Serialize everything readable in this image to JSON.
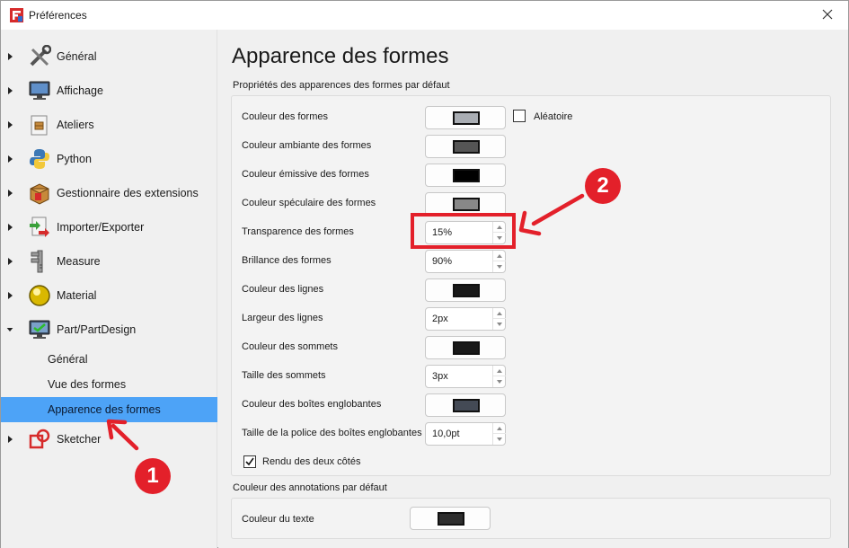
{
  "window": {
    "title": "Préférences"
  },
  "sidebar": {
    "items": [
      {
        "label": "Général",
        "icon": "tools-icon"
      },
      {
        "label": "Affichage",
        "icon": "monitor-icon"
      },
      {
        "label": "Ateliers",
        "icon": "workbench-icon"
      },
      {
        "label": "Python",
        "icon": "python-icon"
      },
      {
        "label": "Gestionnaire des extensions",
        "icon": "addon-manager-icon"
      },
      {
        "label": "Importer/Exporter",
        "icon": "import-export-icon"
      },
      {
        "label": "Measure",
        "icon": "caliper-icon"
      },
      {
        "label": "Material",
        "icon": "material-sphere-icon"
      },
      {
        "label": "Part/PartDesign",
        "icon": "part-design-icon",
        "expanded": true
      }
    ],
    "subitems": [
      {
        "label": "Général"
      },
      {
        "label": "Vue des formes"
      },
      {
        "label": "Apparence des formes",
        "selected": true
      }
    ],
    "last_item": {
      "label": "Sketcher",
      "icon": "sketcher-icon"
    }
  },
  "main": {
    "title": "Apparence des formes",
    "group1": {
      "title": "Propriétés des apparences des formes par défaut",
      "rows": [
        {
          "label": "Couleur des formes",
          "type": "color",
          "color": "#a9adb3"
        },
        {
          "label": "Couleur ambiante des formes",
          "type": "color",
          "color": "#555555"
        },
        {
          "label": "Couleur émissive des formes",
          "type": "color",
          "color": "#000000"
        },
        {
          "label": "Couleur spéculaire des formes",
          "type": "color",
          "color": "#888888"
        },
        {
          "label": "Transparence des formes",
          "type": "spin",
          "value": "15%"
        },
        {
          "label": "Brillance des formes",
          "type": "spin",
          "value": "90%"
        },
        {
          "label": "Couleur des lignes",
          "type": "color",
          "color": "#191919"
        },
        {
          "label": "Largeur des lignes",
          "type": "spin",
          "value": "2px"
        },
        {
          "label": "Couleur des sommets",
          "type": "color",
          "color": "#191919"
        },
        {
          "label": "Taille des sommets",
          "type": "spin",
          "value": "3px"
        },
        {
          "label": "Couleur des boîtes englobantes",
          "type": "color",
          "color": "#444a55"
        },
        {
          "label": "Taille de la police des boîtes englobantes",
          "type": "spin",
          "value": "10,0pt"
        }
      ],
      "random_label": "Aléatoire",
      "two_side_label": "Rendu des deux côtés",
      "two_side_checked": true
    },
    "group2": {
      "title": "Couleur des annotations par défaut",
      "text_color_label": "Couleur du texte",
      "text_color": "#2e2e2e"
    }
  },
  "annotations": {
    "callout1": "1",
    "callout2": "2",
    "accent": "#e3202a"
  },
  "colors": {
    "selection": "#4da3f7"
  }
}
